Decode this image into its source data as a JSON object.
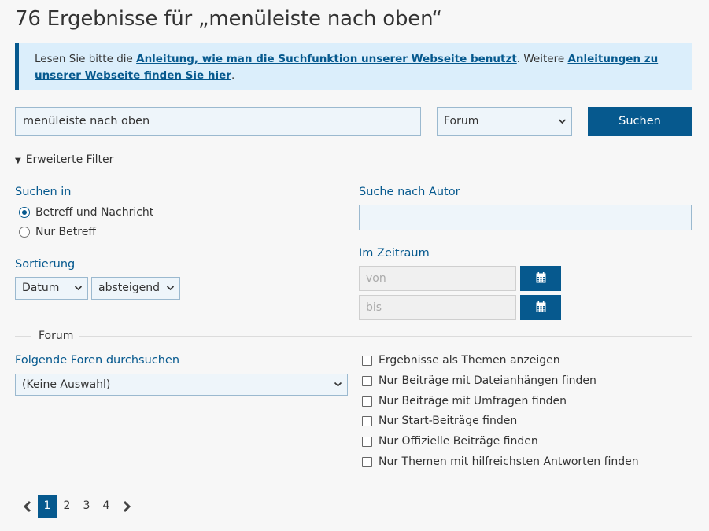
{
  "page": {
    "title": "76 Ergebnisse für „menüleiste nach oben“"
  },
  "info": {
    "prefix": "Lesen Sie bitte die ",
    "link1": "Anleitung, wie man die Suchfunktion unserer Webseite benutzt",
    "middle": ". Weitere ",
    "link2": "Anleitungen zu unserer Webseite finden Sie hier",
    "suffix": "."
  },
  "search": {
    "value": "menüleiste nach oben",
    "scope": "Forum",
    "button": "Suchen"
  },
  "advanced": {
    "toggle": "Erweiterte Filter",
    "search_in_label": "Suchen in",
    "search_in_options": [
      "Betreff und Nachricht",
      "Nur Betreff"
    ],
    "search_in_selected": 0,
    "author_label": "Suche nach Autor",
    "author_value": "",
    "sort_label": "Sortierung",
    "sort_field": "Datum",
    "sort_order": "absteigend",
    "period_label": "Im Zeitraum",
    "from_placeholder": "von",
    "to_placeholder": "bis"
  },
  "forum": {
    "legend": "Forum",
    "forums_label": "Folgende Foren durchsuchen",
    "forums_value": "(Keine Auswahl)",
    "options": [
      {
        "label": "Ergebnisse als Themen anzeigen",
        "checked": false
      },
      {
        "label": "Nur Beiträge mit Dateianhängen finden",
        "checked": false
      },
      {
        "label": "Nur Beiträge mit Umfragen finden",
        "checked": false
      },
      {
        "label": "Nur Start-Beiträge finden",
        "checked": false
      },
      {
        "label": "Nur Offizielle Beiträge finden",
        "checked": false
      },
      {
        "label": "Nur Themen mit hilfreichsten Antworten finden",
        "checked": false
      }
    ]
  },
  "pagination": {
    "pages": [
      "1",
      "2",
      "3",
      "4"
    ],
    "current": "1"
  },
  "colors": {
    "accent": "#06598e",
    "info_bg": "#dbeefb",
    "input_bg": "#eef5fa"
  },
  "icons": {
    "prev": "chevron-left-icon",
    "next": "chevron-right-icon",
    "calendar": "calendar-icon",
    "dropdown": "chevron-down-icon"
  }
}
